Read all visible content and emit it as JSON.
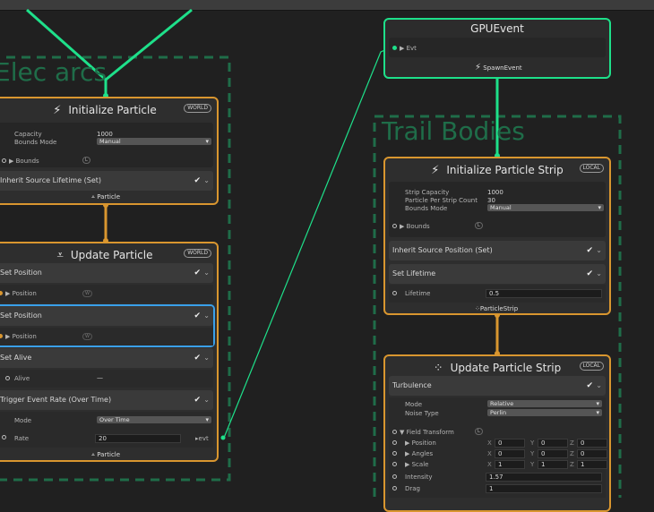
{
  "systems": {
    "elec_arcs": "Elec arcs",
    "trail_bodies": "Trail Bodies"
  },
  "init_particle": {
    "title": "Initialize Particle",
    "space": "WORLD",
    "capacity_label": "Capacity",
    "capacity_value": "1000",
    "bounds_mode_label": "Bounds Mode",
    "bounds_mode_value": "Manual",
    "bounds_label": "Bounds",
    "bounds_badge": "L",
    "block_label": "Inherit Source Lifetime (Set)",
    "output_label": "Particle"
  },
  "update_particle": {
    "title": "Update Particle",
    "space": "WORLD",
    "set_position_1": "Set Position",
    "position_1": "Position",
    "pos_badge_1": "W",
    "set_position_2": "Set Position",
    "position_2": "Position",
    "pos_badge_2": "W",
    "set_alive": "Set Alive",
    "alive_label": "Alive",
    "alive_value": "—",
    "trigger": "Trigger Event Rate (Over Time)",
    "mode_label": "Mode",
    "mode_value": "Over Time",
    "rate_label": "Rate",
    "rate_value": "20",
    "evt_label": "evt",
    "output_label": "Particle"
  },
  "gpu_event": {
    "title": "GPUEvent",
    "evt_label": "Evt",
    "spawn_label": "SpawnEvent"
  },
  "init_strip": {
    "title": "Initialize Particle Strip",
    "space": "LOCAL",
    "strip_capacity_label": "Strip Capacity",
    "strip_capacity_value": "1000",
    "per_strip_label": "Particle Per Strip Count",
    "per_strip_value": "30",
    "bounds_mode_label": "Bounds Mode",
    "bounds_mode_value": "Manual",
    "bounds_label": "Bounds",
    "bounds_badge": "L",
    "inherit_label": "Inherit Source Position (Set)",
    "set_lifetime": "Set Lifetime",
    "lifetime_label": "Lifetime",
    "lifetime_value": "0.5",
    "output_label": "ParticleStrip"
  },
  "update_strip": {
    "title": "Update Particle Strip",
    "space": "LOCAL",
    "turbulence": "Turbulence",
    "mode_label": "Mode",
    "mode_value": "Relative",
    "noise_label": "Noise Type",
    "noise_value": "Perlin",
    "field_transform": "Field Transform",
    "ft_badge": "L",
    "position_label": "Position",
    "angles_label": "Angles",
    "scale_label": "Scale",
    "axis_x": "X",
    "axis_y": "Y",
    "axis_z": "Z",
    "pos_x": "0",
    "pos_y": "0",
    "pos_z": "0",
    "ang_x": "0",
    "ang_y": "0",
    "ang_z": "0",
    "scl_x": "1",
    "scl_y": "1",
    "scl_z": "1",
    "intensity_label": "Intensity",
    "intensity_value": "1.57",
    "drag_label": "Drag",
    "drag_value": "1"
  },
  "colors": {
    "flow": "#1ee08a",
    "context_border": "#d9962f",
    "system_dash": "#1f6d49",
    "selection": "#3aa0ea"
  }
}
